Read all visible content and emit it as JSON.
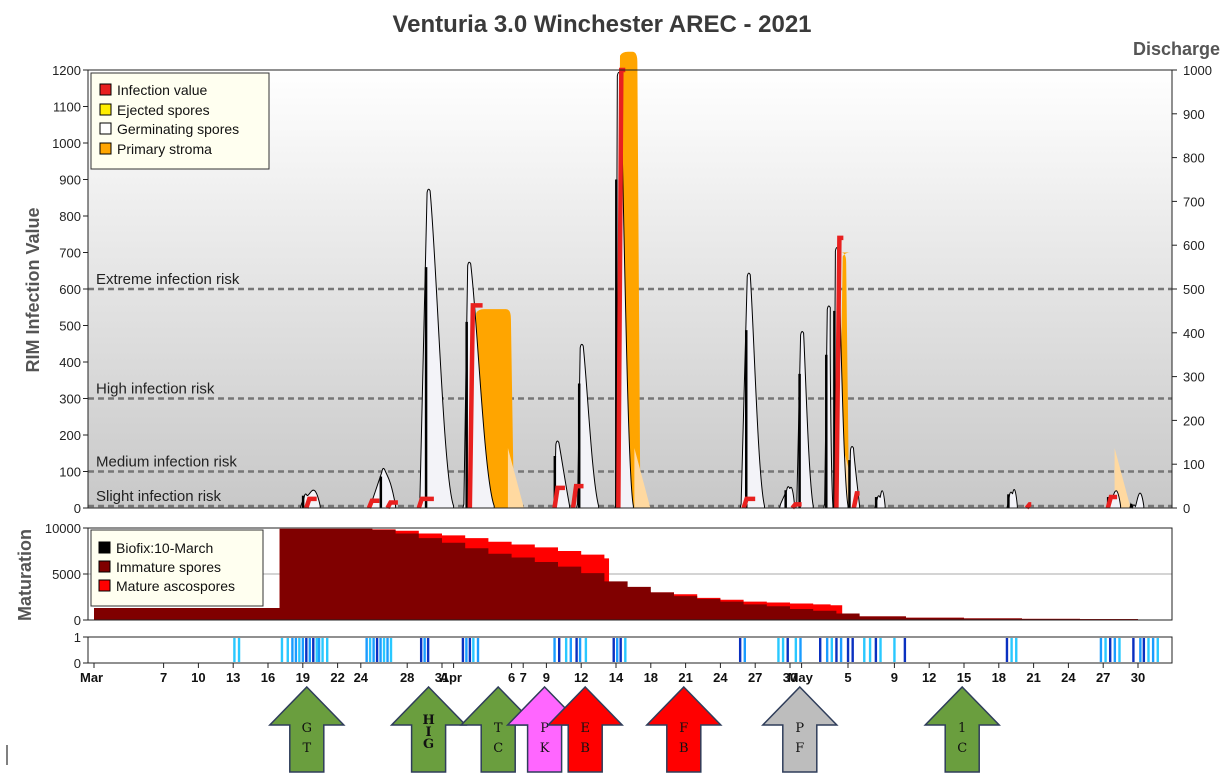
{
  "chart_data": [
    {
      "type": "area",
      "title": "Venturia 3.0  Winchester AREC - 2021",
      "ylabel": "RIM Infection Value",
      "ylabel_right": "Discharge",
      "ylim": [
        0,
        1200
      ],
      "ylim_right": [
        0,
        1000
      ],
      "yticks": [
        0,
        100,
        200,
        300,
        400,
        500,
        600,
        700,
        800,
        900,
        1000,
        1100,
        1200
      ],
      "yticks_right": [
        0,
        100,
        200,
        300,
        400,
        500,
        600,
        700,
        800,
        900,
        1000
      ],
      "risk_levels": [
        {
          "label": "Extreme infection risk",
          "value": 600
        },
        {
          "label": "High infection risk",
          "value": 300
        },
        {
          "label": "Medium infection risk",
          "value": 100
        },
        {
          "label": "Slight infection risk",
          "value": 10
        }
      ],
      "legend": {
        "placement": "top-left",
        "entries": [
          {
            "label": "Infection value",
            "color": "#e8201f"
          },
          {
            "label": "Ejected spores",
            "color": "#ffee00"
          },
          {
            "label": "Germinating spores",
            "color": "#ffffff"
          },
          {
            "label": "Primary stroma",
            "color": "#ffa500"
          }
        ]
      },
      "germinating_spores": [
        {
          "start": 17.8,
          "peak": 18.2,
          "end": 19.5,
          "value": 45
        },
        {
          "start": 23.8,
          "peak": 24.9,
          "end": 26.0,
          "value": 115
        },
        {
          "start": 28.0,
          "peak": 28.8,
          "end": 31.0,
          "value": 880
        },
        {
          "start": 31.8,
          "peak": 32.3,
          "end": 34.5,
          "value": 680
        },
        {
          "start": 39.6,
          "peak": 39.9,
          "end": 41.0,
          "value": 190
        },
        {
          "start": 41.6,
          "peak": 42.0,
          "end": 43.5,
          "value": 455
        },
        {
          "start": 44.9,
          "peak": 45.2,
          "end": 46.5,
          "value": 1200
        },
        {
          "start": 55.7,
          "peak": 56.4,
          "end": 57.8,
          "value": 650
        },
        {
          "start": 59.1,
          "peak": 59.8,
          "end": 60.4,
          "value": 65
        },
        {
          "start": 60.5,
          "peak": 61.0,
          "end": 62.0,
          "value": 490
        },
        {
          "start": 62.9,
          "peak": 63.3,
          "end": 63.7,
          "value": 560
        },
        {
          "start": 63.7,
          "peak": 64.0,
          "end": 65.0,
          "value": 720
        },
        {
          "start": 65.0,
          "peak": 65.3,
          "end": 66.0,
          "value": 175
        },
        {
          "start": 67.3,
          "peak": 67.6,
          "end": 68.2,
          "value": 40
        },
        {
          "start": 78.7,
          "peak": 79.0,
          "end": 79.6,
          "value": 50
        },
        {
          "start": 87.3,
          "peak": 87.6,
          "end": 88.5,
          "value": 40
        },
        {
          "start": 89.3,
          "peak": 89.6,
          "end": 90.5,
          "value": 15
        }
      ],
      "primary_stroma": [
        {
          "start": 32.6,
          "end": 36.2,
          "value": 545
        },
        {
          "start": 45.0,
          "end": 47.1,
          "value": 1250
        },
        {
          "start": 64.2,
          "end": 65.1,
          "value": 700
        },
        {
          "start": 87.5,
          "end": 88.5,
          "value": 30
        }
      ],
      "infection_value": [
        {
          "start": 18.3,
          "end": 19.2,
          "value": 25
        },
        {
          "start": 23.7,
          "end": 24.6,
          "value": 20
        },
        {
          "start": 25.3,
          "end": 26.2,
          "value": 15
        },
        {
          "start": 28.0,
          "end": 29.3,
          "value": 25
        },
        {
          "start": 32.4,
          "end": 33.5,
          "value": 555
        },
        {
          "start": 39.7,
          "end": 40.6,
          "value": 55
        },
        {
          "start": 41.3,
          "end": 42.2,
          "value": 60
        },
        {
          "start": 45.2,
          "end": 45.8,
          "value": 1200
        },
        {
          "start": 56.0,
          "end": 57.0,
          "value": 25
        },
        {
          "start": 60.2,
          "end": 61.0,
          "value": 10
        },
        {
          "start": 64.0,
          "end": 64.6,
          "value": 740
        },
        {
          "start": 65.5,
          "end": 66.0,
          "value": 40
        },
        {
          "start": 80.4,
          "end": 80.8,
          "value": 10
        },
        {
          "start": 87.4,
          "end": 88.2,
          "value": 30
        }
      ]
    },
    {
      "type": "area",
      "ylabel": "Maturation",
      "ylim": [
        0,
        10000
      ],
      "yticks": [
        0,
        5000,
        10000
      ],
      "legend": {
        "placement": "top-left",
        "entries": [
          {
            "label": "Biofix:10-March",
            "color": "#000000"
          },
          {
            "label": "Immature spores",
            "color": "#800000"
          },
          {
            "label": "Mature ascospores",
            "color": "#ff0000"
          }
        ]
      },
      "immature_spores": {
        "x": [
          0,
          15.9,
          16.0,
          24,
          26,
          28,
          30,
          32,
          34,
          36,
          38,
          40,
          42,
          44,
          46,
          48,
          50,
          52,
          54,
          56,
          58,
          60,
          62,
          64,
          66,
          70,
          75,
          80,
          85,
          90,
          92
        ],
        "values": [
          1300,
          1300,
          9900,
          9800,
          9400,
          8900,
          8400,
          7800,
          7200,
          6800,
          6300,
          5800,
          5100,
          4200,
          3600,
          3000,
          2600,
          2300,
          2000,
          1700,
          1500,
          1200,
          1000,
          700,
          400,
          250,
          180,
          120,
          100,
          60,
          50
        ]
      },
      "mature_ascospores": {
        "x": [
          0,
          15.9,
          16.0,
          24,
          26,
          28,
          30,
          32,
          34,
          36,
          38,
          40,
          42,
          44,
          44.4,
          46,
          48,
          50,
          52,
          54,
          56,
          58,
          60,
          62,
          63.5,
          64.5,
          66,
          70,
          75,
          80,
          85,
          90,
          92
        ],
        "values": [
          1300,
          1300,
          9900,
          9850,
          9700,
          9400,
          9200,
          8900,
          8500,
          8200,
          7900,
          7500,
          7100,
          6700,
          3200,
          3100,
          3000,
          2800,
          2400,
          2200,
          2000,
          1900,
          1800,
          1700,
          1600,
          500,
          400,
          250,
          180,
          120,
          100,
          60,
          50
        ]
      }
    },
    {
      "type": "heatmap",
      "yticks": [
        0,
        1
      ],
      "bars": [
        [
          12.0,
          "#29c8ff"
        ],
        [
          12.4,
          "#29c8ff"
        ],
        [
          16.1,
          "#29c8ff"
        ],
        [
          16.6,
          "#29c8ff"
        ],
        [
          17.0,
          "#1a9cff"
        ],
        [
          17.3,
          "#1a9cff"
        ],
        [
          17.6,
          "#29c8ff"
        ],
        [
          17.9,
          "#1a9cff"
        ],
        [
          18.2,
          "#0a30c0"
        ],
        [
          18.5,
          "#1a9cff"
        ],
        [
          18.8,
          "#0a30c0"
        ],
        [
          19.1,
          "#29c8ff"
        ],
        [
          19.3,
          "#1a9cff"
        ],
        [
          19.6,
          "#29c8ff"
        ],
        [
          20.0,
          "#29c8ff"
        ],
        [
          23.4,
          "#1a9cff"
        ],
        [
          23.7,
          "#29c8ff"
        ],
        [
          24.0,
          "#1a9cff"
        ],
        [
          24.3,
          "#0a30c0"
        ],
        [
          24.6,
          "#1a9cff"
        ],
        [
          24.9,
          "#29c8ff"
        ],
        [
          25.2,
          "#1a9cff"
        ],
        [
          25.5,
          "#29c8ff"
        ],
        [
          28.1,
          "#0a30c0"
        ],
        [
          28.4,
          "#1a9cff"
        ],
        [
          28.7,
          "#0a30c0"
        ],
        [
          31.7,
          "#0a30c0"
        ],
        [
          32.0,
          "#1a9cff"
        ],
        [
          32.3,
          "#0a30c0"
        ],
        [
          32.6,
          "#29c8ff"
        ],
        [
          33.0,
          "#1a9cff"
        ],
        [
          39.6,
          "#1a9cff"
        ],
        [
          40.0,
          "#0a30c0"
        ],
        [
          40.6,
          "#29c8ff"
        ],
        [
          41.0,
          "#1a9cff"
        ],
        [
          41.5,
          "#0a30c0"
        ],
        [
          41.8,
          "#1a9cff"
        ],
        [
          42.3,
          "#29c8ff"
        ],
        [
          44.7,
          "#0a30c0"
        ],
        [
          45.0,
          "#1a9cff"
        ],
        [
          45.3,
          "#0a30c0"
        ],
        [
          45.7,
          "#29c8ff"
        ],
        [
          55.6,
          "#0a30c0"
        ],
        [
          56.0,
          "#1a9cff"
        ],
        [
          58.9,
          "#29c8ff"
        ],
        [
          59.3,
          "#29c8ff"
        ],
        [
          59.7,
          "#0a30c0"
        ],
        [
          60.4,
          "#29c8ff"
        ],
        [
          60.8,
          "#1a9cff"
        ],
        [
          62.5,
          "#0a30c0"
        ],
        [
          63.1,
          "#1a9cff"
        ],
        [
          63.5,
          "#29c8ff"
        ],
        [
          63.9,
          "#0a30c0"
        ],
        [
          64.3,
          "#1a9cff"
        ],
        [
          64.9,
          "#0a30c0"
        ],
        [
          65.3,
          "#0a30c0"
        ],
        [
          66.3,
          "#29c8ff"
        ],
        [
          66.8,
          "#29c8ff"
        ],
        [
          67.3,
          "#0a30c0"
        ],
        [
          67.7,
          "#29c8ff"
        ],
        [
          68.9,
          "#29c8ff"
        ],
        [
          69.8,
          "#0a30c0"
        ],
        [
          78.6,
          "#0a30c0"
        ],
        [
          79.0,
          "#29c8ff"
        ],
        [
          79.4,
          "#29c8ff"
        ],
        [
          86.7,
          "#1a9cff"
        ],
        [
          87.1,
          "#29c8ff"
        ],
        [
          87.5,
          "#0a30c0"
        ],
        [
          87.9,
          "#1a9cff"
        ],
        [
          88.3,
          "#29c8ff"
        ],
        [
          89.5,
          "#0a30c0"
        ],
        [
          90.1,
          "#1a9cff"
        ],
        [
          90.4,
          "#0a30c0"
        ],
        [
          90.8,
          "#29c8ff"
        ],
        [
          91.2,
          "#1a9cff"
        ],
        [
          91.6,
          "#29c8ff"
        ]
      ]
    }
  ],
  "x_axis": {
    "ticks": [
      {
        "day": 0,
        "label": "Mar",
        "month": true
      },
      {
        "day": 6,
        "label": "7"
      },
      {
        "day": 9,
        "label": "10"
      },
      {
        "day": 12,
        "label": "13"
      },
      {
        "day": 15,
        "label": "16"
      },
      {
        "day": 18,
        "label": "19"
      },
      {
        "day": 21,
        "label": "22"
      },
      {
        "day": 23,
        "label": "24"
      },
      {
        "day": 27,
        "label": "28"
      },
      {
        "day": 30,
        "label": "31"
      },
      {
        "day": 31,
        "label": "Apr",
        "month": true
      },
      {
        "day": 36,
        "label": "6"
      },
      {
        "day": 37,
        "label": "7"
      },
      {
        "day": 39,
        "label": "9"
      },
      {
        "day": 42,
        "label": "12"
      },
      {
        "day": 45,
        "label": "14"
      },
      {
        "day": 48,
        "label": "18"
      },
      {
        "day": 51,
        "label": "21"
      },
      {
        "day": 54,
        "label": "24"
      },
      {
        "day": 57,
        "label": "27"
      },
      {
        "day": 60,
        "label": "30"
      },
      {
        "day": 61,
        "label": "May",
        "month": true
      },
      {
        "day": 65,
        "label": "5"
      },
      {
        "day": 69,
        "label": "9"
      },
      {
        "day": 72,
        "label": "12"
      },
      {
        "day": 75,
        "label": "15"
      },
      {
        "day": 78,
        "label": "18"
      },
      {
        "day": 81,
        "label": "21"
      },
      {
        "day": 84,
        "label": "24"
      },
      {
        "day": 87,
        "label": "27"
      },
      {
        "day": 90,
        "label": "30"
      }
    ]
  },
  "arrows": [
    {
      "text": "G\nT",
      "color": "#6a9e3e",
      "day": 18
    },
    {
      "text": "H\nI\nG",
      "color": "#6a9e3e",
      "day": 28.5
    },
    {
      "text": "T\nC",
      "color": "#6a9e3e",
      "day": 34.5
    },
    {
      "text": "P\nK",
      "color": "#ff66ff",
      "day": 38.5
    },
    {
      "text": "E\nB",
      "color": "#ff0000",
      "day": 42
    },
    {
      "text": "F\nB",
      "color": "#ff0000",
      "day": 50.5
    },
    {
      "text": "P\nF",
      "color": "#bdbdbd",
      "day": 60.5
    },
    {
      "text": "1\nC",
      "color": "#6a9e3e",
      "day": 74.5
    }
  ]
}
